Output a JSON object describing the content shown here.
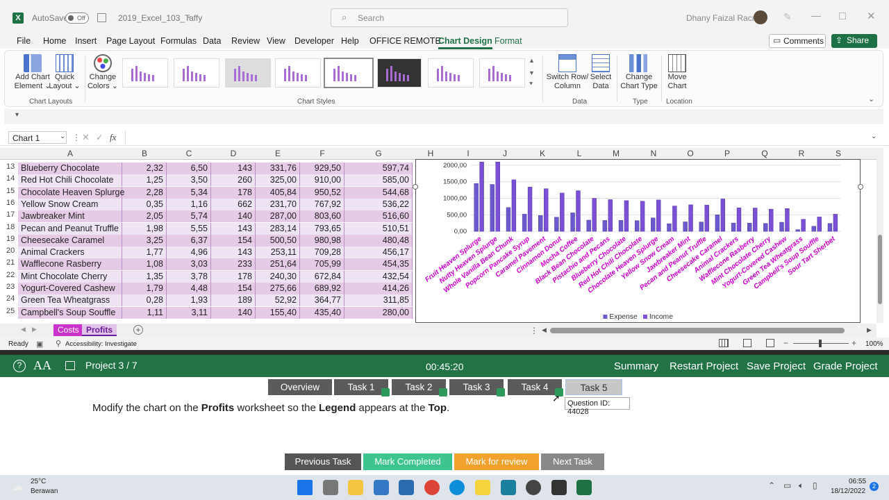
{
  "title_bar": {
    "autosave_label": "AutoSave",
    "autosave_state": "Off",
    "file_name": "2019_Excel_103_Taffy",
    "search_placeholder": "Search",
    "user_name": "Dhany Faizal Racma"
  },
  "menu": [
    "File",
    "Home",
    "Insert",
    "Page Layout",
    "Formulas",
    "Data",
    "Review",
    "View",
    "Developer",
    "Help",
    "OFFICE REMOTE",
    "Chart Design",
    "Format"
  ],
  "menu_active": "Chart Design",
  "buttons": {
    "comments": "Comments",
    "share": "Share"
  },
  "ribbon": {
    "add_chart_element": [
      "Add Chart",
      "Element"
    ],
    "quick_layout": [
      "Quick",
      "Layout"
    ],
    "change_colors": [
      "Change",
      "Colors"
    ],
    "switch_row_column": [
      "Switch Row/",
      "Column"
    ],
    "select_data": [
      "Select",
      "Data"
    ],
    "change_chart_type": [
      "Change",
      "Chart Type"
    ],
    "move_chart": [
      "Move",
      "Chart"
    ],
    "groups": {
      "chart_layouts": "Chart Layouts",
      "chart_styles": "Chart Styles",
      "data": "Data",
      "type": "Type",
      "location": "Location"
    }
  },
  "name_box": "Chart 1",
  "fx": "fx",
  "columns": [
    "A",
    "B",
    "C",
    "D",
    "E",
    "F",
    "G",
    "H",
    "I",
    "J",
    "K",
    "L",
    "M",
    "N",
    "O",
    "P",
    "Q",
    "R",
    "S"
  ],
  "rows": [
    {
      "n": "13",
      "a": "Blueberry Chocolate",
      "b": "2,32",
      "c": "6,50",
      "d": "143",
      "e": "331,76",
      "f": "929,50",
      "g": "597,74"
    },
    {
      "n": "14",
      "a": "Red Hot Chili Chocolate",
      "b": "1,25",
      "c": "3,50",
      "d": "260",
      "e": "325,00",
      "f": "910,00",
      "g": "585,00"
    },
    {
      "n": "15",
      "a": "Chocolate Heaven Splurge",
      "b": "2,28",
      "c": "5,34",
      "d": "178",
      "e": "405,84",
      "f": "950,52",
      "g": "544,68"
    },
    {
      "n": "16",
      "a": "Yellow Snow Cream",
      "b": "0,35",
      "c": "1,16",
      "d": "662",
      "e": "231,70",
      "f": "767,92",
      "g": "536,22"
    },
    {
      "n": "17",
      "a": "Jawbreaker Mint",
      "b": "2,05",
      "c": "5,74",
      "d": "140",
      "e": "287,00",
      "f": "803,60",
      "g": "516,60"
    },
    {
      "n": "18",
      "a": "Pecan and Peanut Truffle",
      "b": "1,98",
      "c": "5,55",
      "d": "143",
      "e": "283,14",
      "f": "793,65",
      "g": "510,51"
    },
    {
      "n": "19",
      "a": "Cheesecake Caramel",
      "b": "3,25",
      "c": "6,37",
      "d": "154",
      "e": "500,50",
      "f": "980,98",
      "g": "480,48"
    },
    {
      "n": "20",
      "a": "Animal Crackers",
      "b": "1,77",
      "c": "4,96",
      "d": "143",
      "e": "253,11",
      "f": "709,28",
      "g": "456,17"
    },
    {
      "n": "21",
      "a": "Wafflecone Rasberry",
      "b": "1,08",
      "c": "3,03",
      "d": "233",
      "e": "251,64",
      "f": "705,99",
      "g": "454,35"
    },
    {
      "n": "22",
      "a": "Mint Chocolate Cherry",
      "b": "1,35",
      "c": "3,78",
      "d": "178",
      "e": "240,30",
      "f": "672,84",
      "g": "432,54"
    },
    {
      "n": "23",
      "a": "Yogurt-Covered Cashew",
      "b": "1,79",
      "c": "4,48",
      "d": "154",
      "e": "275,66",
      "f": "689,92",
      "g": "414,26"
    },
    {
      "n": "24",
      "a": "Green Tea Wheatgrass",
      "b": "0,28",
      "c": "1,93",
      "d": "189",
      "e": "52,92",
      "f": "364,77",
      "g": "311,85"
    },
    {
      "n": "25",
      "a": "Campbell's Soup Souffle",
      "b": "1,11",
      "c": "3,11",
      "d": "140",
      "e": "155,40",
      "f": "435,40",
      "g": "280,00"
    }
  ],
  "chart_data": {
    "type": "bar",
    "categories": [
      "Fruit Heaven Splurge",
      "Nutty Heaven Splurge",
      "Whole Vanilla Bean Chunk",
      "Popcorn Pancake Syrup",
      "Caramel Pavement",
      "Cinnamon Donut",
      "Mocha Coffee",
      "Black Bean Chocolate",
      "Pistachio and Pecans",
      "Blueberry Chocolate",
      "Red Hot Chili Chocolate",
      "Chocolate Heaven Splurge",
      "Yellow Snow Cream",
      "Jawbreaker Mint",
      "Pecan and Peanut Truffle",
      "Cheesecake Caramel",
      "Animal Crackers",
      "Wafflecone Rasberry",
      "Mint Chocolate Cherry",
      "Yogurt-Covered Cashew",
      "Green Tea Wheatgrass",
      "Campbell's Soup Souffle",
      "Sour Tart Sherbet"
    ],
    "series": [
      {
        "name": "Expense",
        "values": [
          1450,
          1420,
          720,
          520,
          480,
          430,
          560,
          340,
          330,
          331.76,
          325,
          405.84,
          231.7,
          287,
          283.14,
          500.5,
          253.11,
          251.64,
          240.3,
          275.66,
          52.92,
          155.4,
          240
        ]
      },
      {
        "name": "Income",
        "values": [
          2100,
          2100,
          1560,
          1340,
          1290,
          1160,
          1230,
          1000,
          960,
          929.5,
          910,
          950.52,
          767.92,
          803.6,
          793.65,
          980.98,
          709.28,
          705.99,
          672.84,
          689.92,
          364.77,
          435.4,
          520
        ]
      }
    ],
    "ytick_labels": [
      "0,00",
      "500,00",
      "1000,00",
      "1500,00",
      "2000,00"
    ],
    "ylim": [
      0,
      2000
    ],
    "legend": [
      "Expense",
      "Income"
    ],
    "legend_position": "bottom",
    "colors": {
      "expense": "#6a5acd",
      "income": "#7b4fd6",
      "labels": "#cc00cc"
    }
  },
  "sheet_tabs": [
    "Costs",
    "Profits"
  ],
  "status": {
    "ready": "Ready",
    "accessibility": "Accessibility: Investigate",
    "zoom": "100%"
  },
  "exam": {
    "project": "Project 3 / 7",
    "timer": "00:45:20",
    "summary": "Summary",
    "restart": "Restart Project",
    "save": "Save Project",
    "grade": "Grade Project",
    "tasks": [
      "Overview",
      "Task 1",
      "Task 2",
      "Task 3",
      "Task 4",
      "Task 5"
    ],
    "tooltip": "Question ID: 44028",
    "question_parts": [
      "Modify the chart on the ",
      "Profits",
      " worksheet so the ",
      "Legend",
      " appears at the ",
      "Top",
      "."
    ],
    "footer": {
      "prev": "Previous Task",
      "complete": "Mark Completed",
      "review": "Mark for review",
      "next": "Next Task"
    }
  },
  "taskbar": {
    "temp": "25°C",
    "weather": "Berawan",
    "time": "06:55",
    "date": "18/12/2022",
    "notif": "2"
  }
}
